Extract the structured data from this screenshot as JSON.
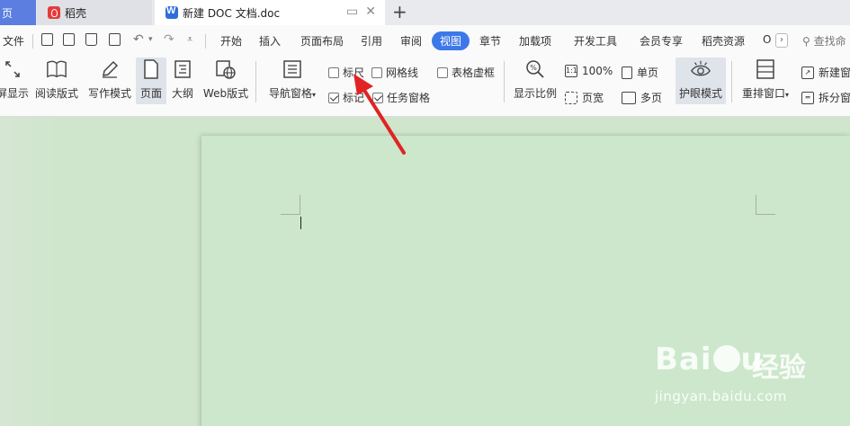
{
  "tabs": {
    "home": "页",
    "daoke": "稻壳",
    "doc": "新建 DOC 文档.doc",
    "new_tab": "+"
  },
  "menu": {
    "file": "文件",
    "items": [
      "开始",
      "插入",
      "页面布局",
      "引用",
      "审阅",
      "视图",
      "章节",
      "加载项",
      "开发工具",
      "会员专享",
      "稻壳资源",
      "O"
    ],
    "active": "视图",
    "search": "查找命"
  },
  "tools": {
    "fullscreen": "屏显示",
    "read_mode": "阅读版式",
    "write_mode": "写作模式",
    "page": "页面",
    "outline": "大纲",
    "web": "Web版式",
    "nav_pane": "导航窗格",
    "ruler": "标尺",
    "gridlines": "网格线",
    "table_gridlines": "表格虚框",
    "markup": "标记",
    "task_pane": "任务窗格",
    "zoom": "显示比例",
    "zoom_100": "100%",
    "page_width": "页宽",
    "single_page": "单页",
    "multi_page": "多页",
    "eye_mode": "护眼模式",
    "rearrange": "重排窗口",
    "new_window": "新建窗",
    "split_window": "拆分窗"
  },
  "checks": {
    "ruler": false,
    "gridlines": false,
    "table_gridlines": false,
    "markup": true,
    "task_pane": true
  },
  "watermark": {
    "cn": "经验",
    "url": "jingyan.baidu.com"
  },
  "colors": {
    "accent": "#3d78e8",
    "eye_green": "#cfe6cd",
    "arrow": "#e02424"
  }
}
